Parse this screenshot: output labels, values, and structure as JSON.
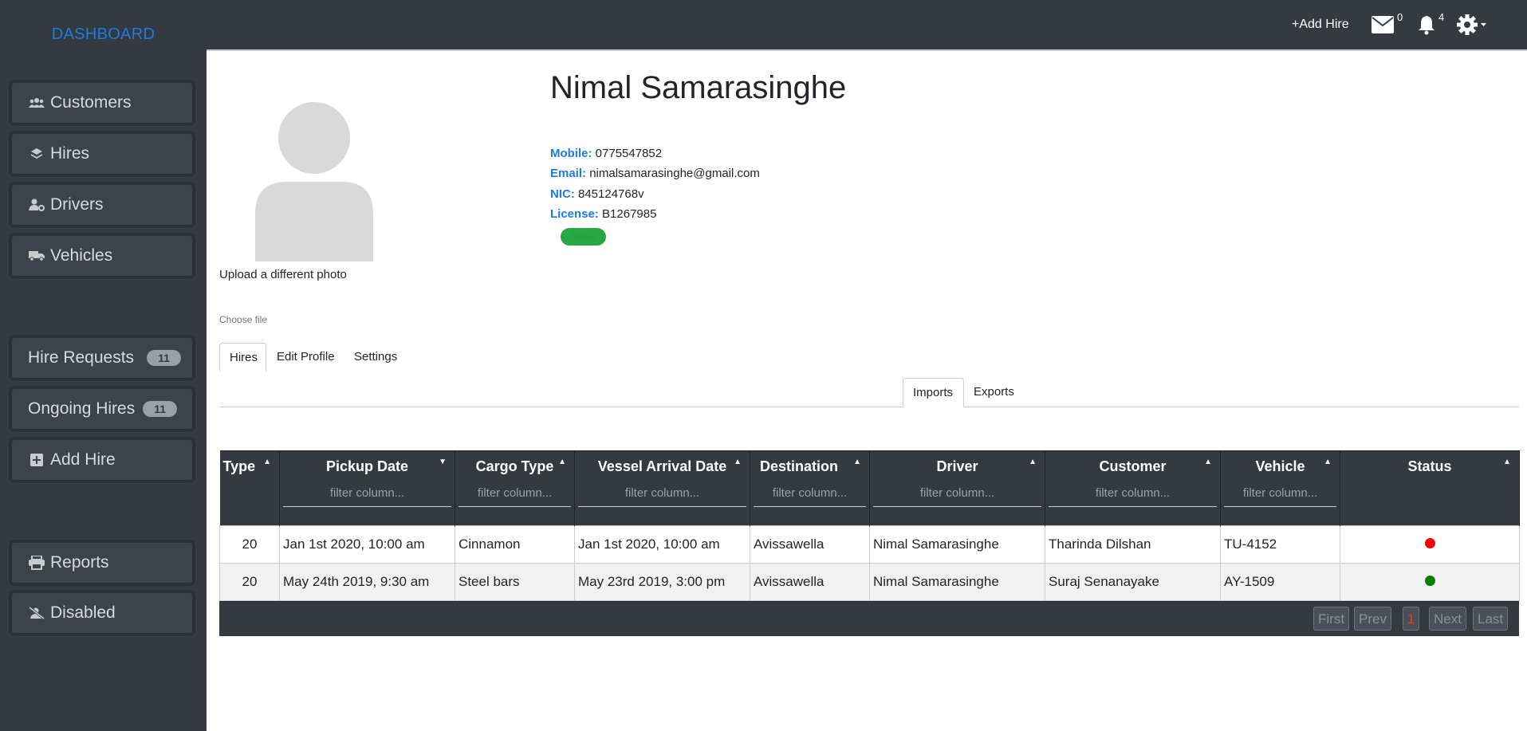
{
  "sidebar": {
    "brand": "DASHBOARD",
    "items": [
      {
        "label": "Customers",
        "icon": "users-icon"
      },
      {
        "label": "Hires",
        "icon": "layers-icon"
      },
      {
        "label": "Drivers",
        "icon": "user-cog-icon"
      },
      {
        "label": "Vehicles",
        "icon": "truck-icon"
      },
      {
        "label": "Hire Requests",
        "badge": "11"
      },
      {
        "label": "Ongoing Hires",
        "badge": "11"
      },
      {
        "label": "Add Hire",
        "icon": "plus-square-icon"
      },
      {
        "label": "Reports",
        "icon": "printer-icon"
      },
      {
        "label": "Disabled",
        "icon": "user-slash-icon"
      }
    ]
  },
  "topbar": {
    "add_hire": "+Add Hire",
    "messages_count": "0",
    "notifications_count": "4"
  },
  "profile": {
    "name": "Nimal Samarasinghe",
    "upload_label": "Upload a different photo",
    "choose_file": "Choose file",
    "mobile_key": "Mobile:",
    "mobile": "0775547852",
    "email_key": "Email:",
    "email": "nimalsamarasinghe@gmail.com",
    "nic_key": "NIC:",
    "nic": "845124768v",
    "license_key": "License:",
    "license": "B1267985",
    "status": "Active"
  },
  "tabs": [
    "Hires",
    "Edit Profile",
    "Settings"
  ],
  "subtabs": [
    "Imports",
    "Exports"
  ],
  "table": {
    "columns": [
      "Type",
      "Pickup Date",
      "Cargo Type",
      "Vessel Arrival Date",
      "Destination",
      "Driver",
      "Customer",
      "Vehicle",
      "Status"
    ],
    "filter_placeholder": "filter column...",
    "rows": [
      {
        "type": "20",
        "pickup": "Jan 1st 2020, 10:00 am",
        "cargo": "Cinnamon",
        "vessel": "Jan 1st 2020, 10:00 am",
        "destination": "Avissawella",
        "driver": "Nimal Samarasinghe",
        "customer": "Tharinda Dilshan",
        "vehicle": "TU-4152",
        "status_color": "#ff0000"
      },
      {
        "type": "20",
        "pickup": "May 24th 2019, 9:30 am",
        "cargo": "Steel bars",
        "vessel": "May 23rd 2019, 3:00 pm",
        "destination": "Avissawella",
        "driver": "Nimal Samarasinghe",
        "customer": "Suraj Senanayake",
        "vehicle": "AY-1509",
        "status_color": "#008000"
      }
    ]
  },
  "pager": {
    "first": "First",
    "prev": "Prev",
    "page": "1",
    "next": "Next",
    "last": "Last"
  },
  "colors": {
    "sidebar_bg": "#343a40",
    "accent": "#1e7be6",
    "active_green": "#28a745"
  }
}
